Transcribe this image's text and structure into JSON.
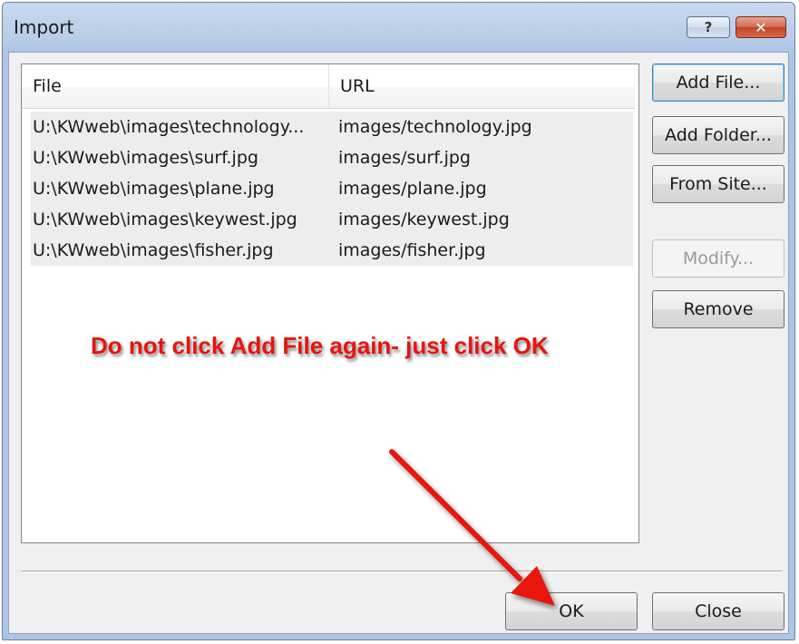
{
  "window": {
    "title": "Import",
    "help_label": "?",
    "close_label": "✕"
  },
  "list": {
    "columns": [
      "File",
      "URL"
    ],
    "rows": [
      {
        "file": "U:\\KWweb\\images\\technology...",
        "url": "images/technology.jpg"
      },
      {
        "file": "U:\\KWweb\\images\\surf.jpg",
        "url": "images/surf.jpg"
      },
      {
        "file": "U:\\KWweb\\images\\plane.jpg",
        "url": "images/plane.jpg"
      },
      {
        "file": "U:\\KWweb\\images\\keywest.jpg",
        "url": "images/keywest.jpg"
      },
      {
        "file": "U:\\KWweb\\images\\fisher.jpg",
        "url": "images/fisher.jpg"
      }
    ]
  },
  "buttons": {
    "add_file": "Add File...",
    "add_folder": "Add Folder...",
    "from_site": "From Site...",
    "modify": "Modify...",
    "remove": "Remove",
    "ok": "OK",
    "close": "Close"
  },
  "annotation": {
    "text": "Do not click Add File again- just click OK",
    "color": "#e8140f"
  }
}
